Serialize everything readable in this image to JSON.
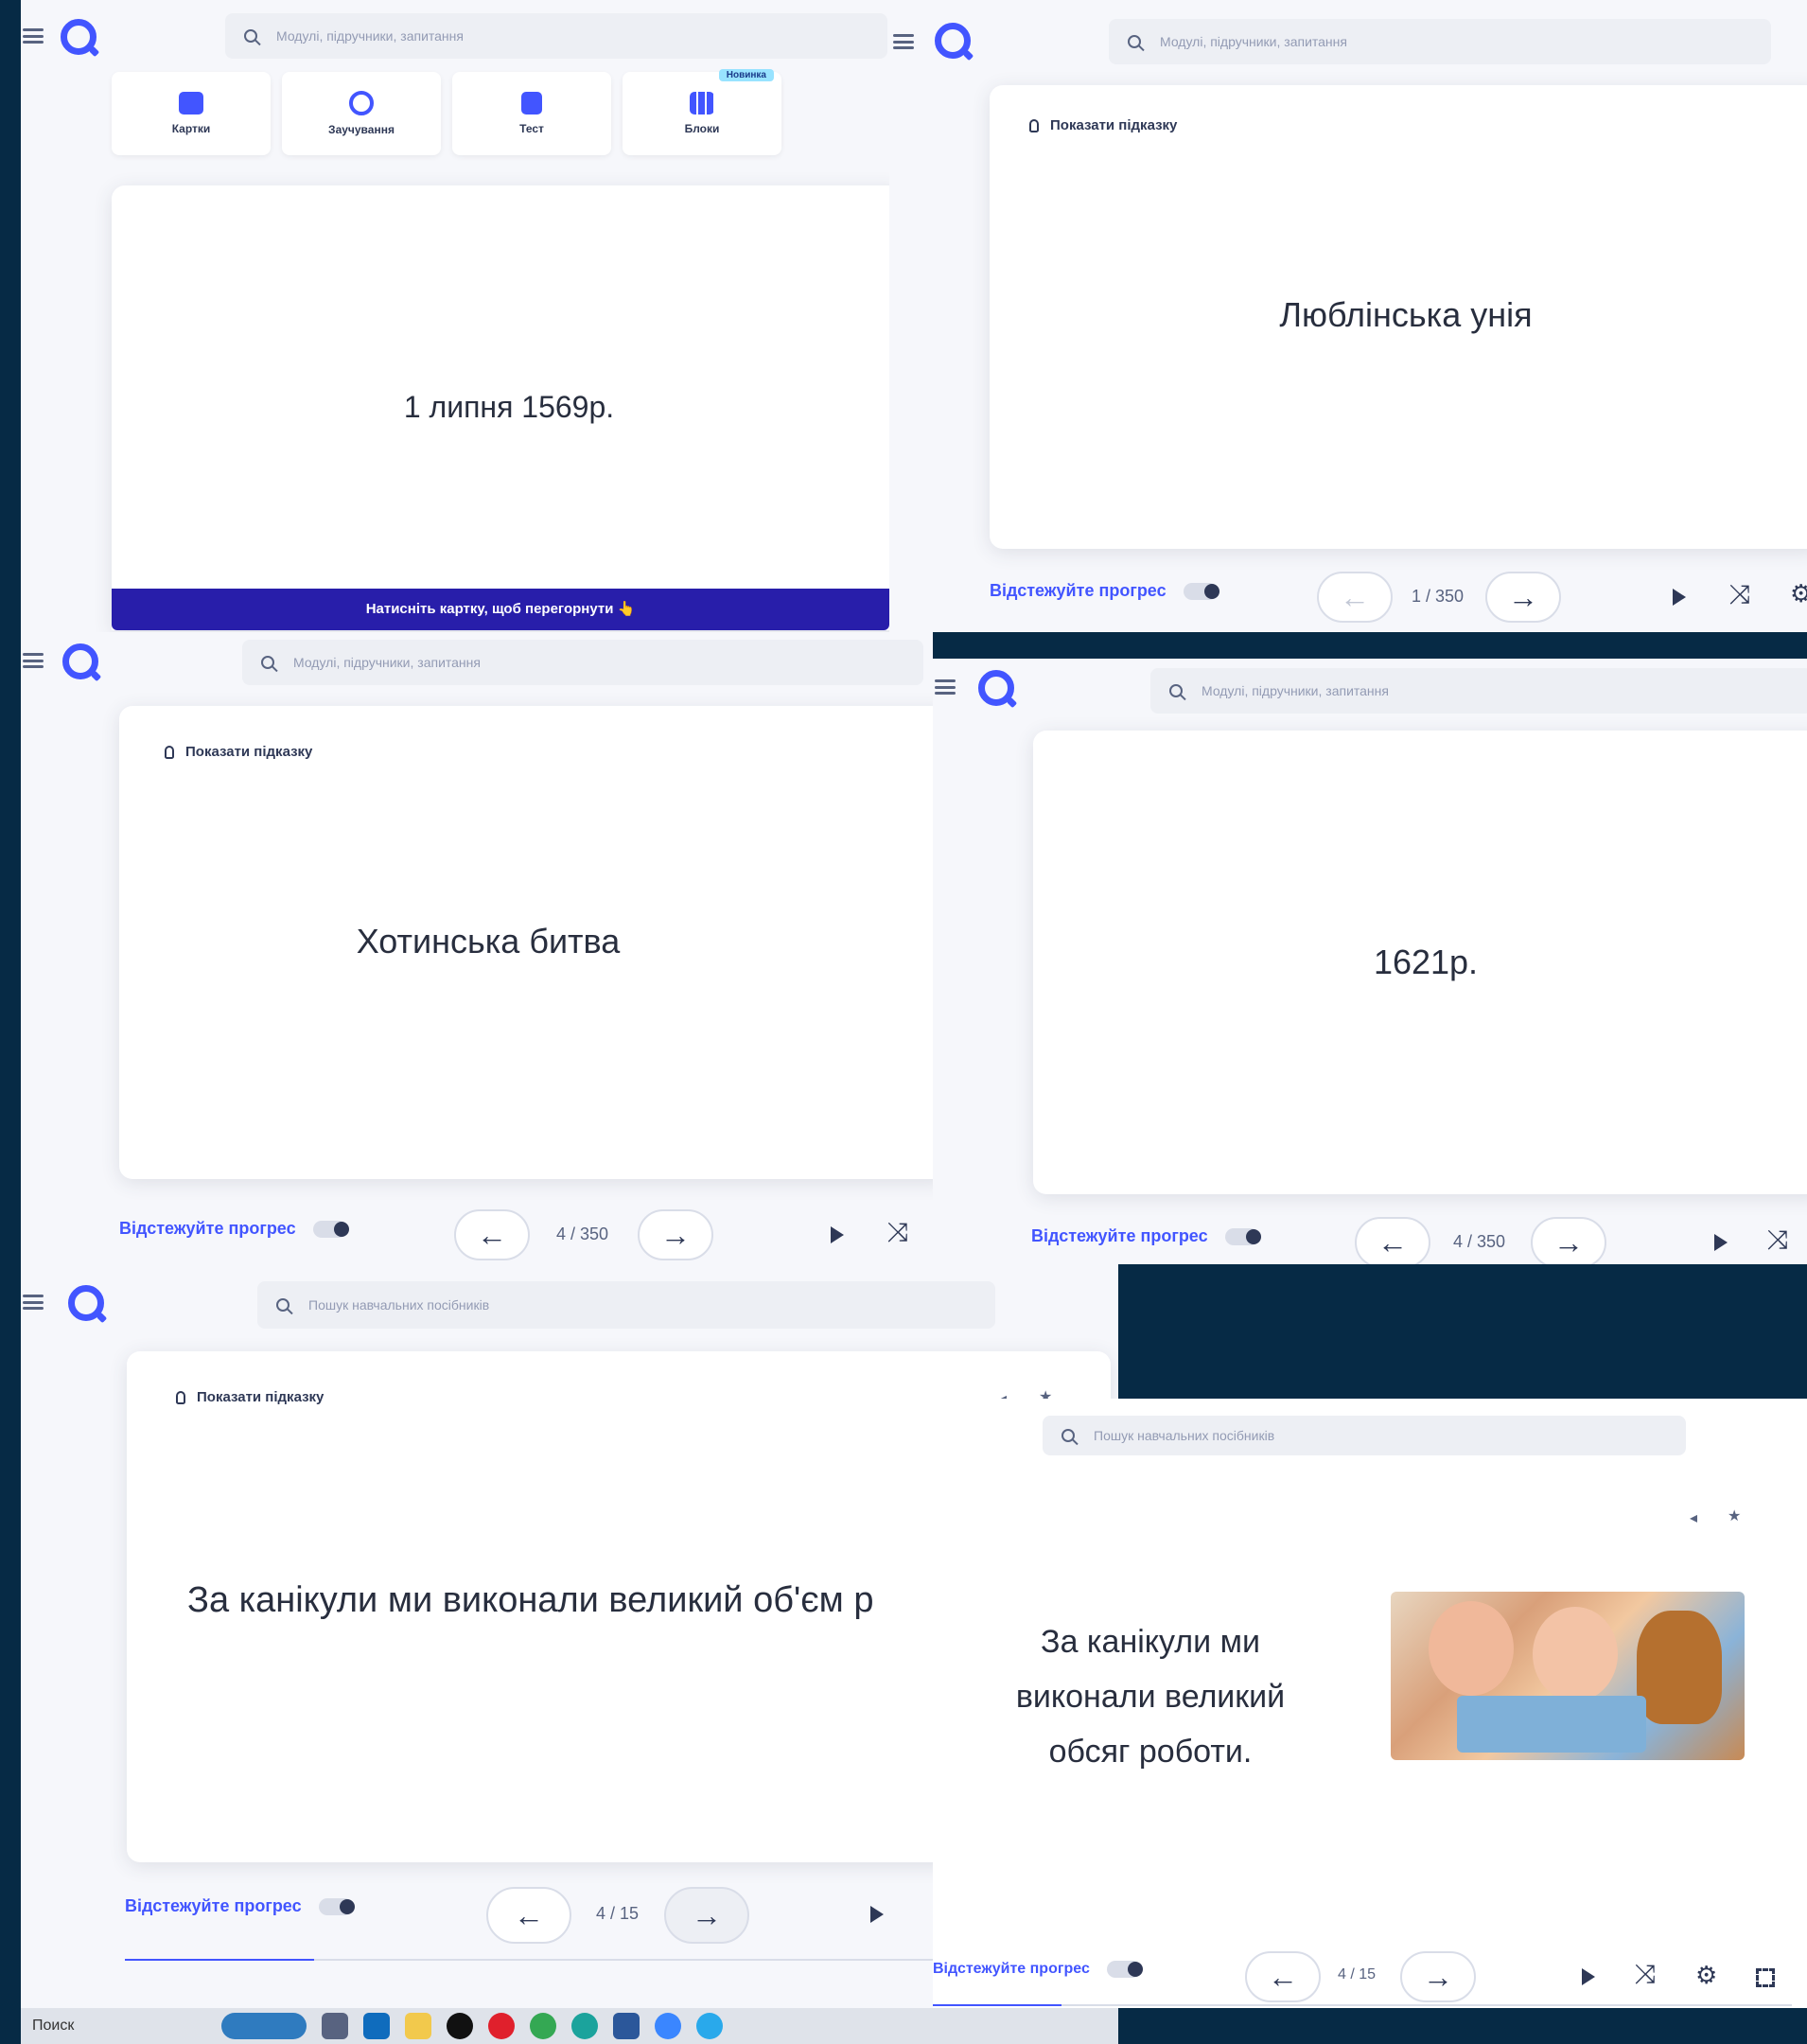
{
  "search": {
    "placeholder_modules": "Модулі, підручники, запитання",
    "placeholder_resources": "Пошук навчальних посібників"
  },
  "modes": [
    {
      "label": "Картки",
      "color": "#4255ff"
    },
    {
      "label": "Заучування",
      "color": "#4255ff"
    },
    {
      "label": "Тест",
      "color": "#4255ff"
    },
    {
      "label": "Блоки",
      "color": "#4255ff",
      "badge": "Новинка"
    }
  ],
  "cards": {
    "panel1": {
      "term": "1 липня 1569р.",
      "banner": "Натисніть картку, щоб перегорнути 👆"
    },
    "panel2": {
      "hint": "Показати підказку",
      "term": "Люблінська унія",
      "counter": "1 / 350"
    },
    "panel3": {
      "hint": "Показати підказку",
      "term": "Хотинська битва",
      "counter": "4 / 350"
    },
    "panel4": {
      "term": "1621р.",
      "counter": "4 / 350"
    },
    "panel5": {
      "hint": "Показати підказку",
      "term": "За канікули ми виконали великий об'єм р",
      "counter": "4 / 15"
    },
    "panel6": {
      "term": "За канікули ми виконали великий обсяг роботи.",
      "counter": "4 / 15"
    }
  },
  "controls": {
    "track_progress": "Відстежуйте прогрес"
  },
  "taskbar": {
    "search_label": "Поиск"
  },
  "colors": {
    "accent": "#4255ff",
    "banner": "#281eaa",
    "background": "#062a45"
  }
}
